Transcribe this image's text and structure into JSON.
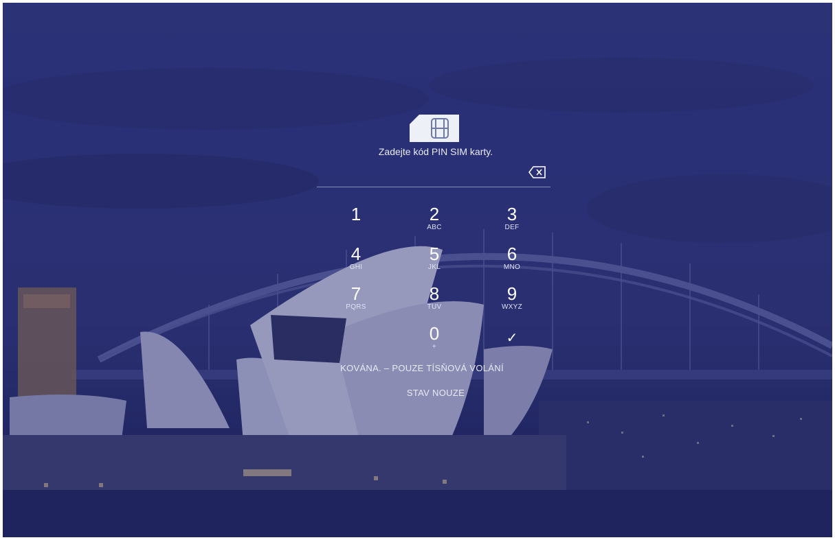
{
  "sim_lock": {
    "prompt": "Zadejte kód PIN SIM karty.",
    "status_message": "KOVÁNA. – POUZE TÍSŇOVÁ VOLÁNÍ",
    "emergency_label": "STAV NOUZE"
  },
  "keypad": {
    "keys": [
      {
        "digit": "1",
        "letters": ""
      },
      {
        "digit": "2",
        "letters": "ABC"
      },
      {
        "digit": "3",
        "letters": "DEF"
      },
      {
        "digit": "4",
        "letters": "GHI"
      },
      {
        "digit": "5",
        "letters": "JKL"
      },
      {
        "digit": "6",
        "letters": "MNO"
      },
      {
        "digit": "7",
        "letters": "PQRS"
      },
      {
        "digit": "8",
        "letters": "TUV"
      },
      {
        "digit": "9",
        "letters": "WXYZ"
      },
      {
        "digit": "0",
        "letters": "+"
      },
      {
        "digit": "✓",
        "letters": ""
      }
    ]
  },
  "icons": {
    "sim": "sim-card-icon",
    "backspace": "backspace-icon",
    "enter": "checkmark-icon"
  },
  "colors": {
    "overlay": "#2b3373",
    "text": "#e8eaf6"
  }
}
